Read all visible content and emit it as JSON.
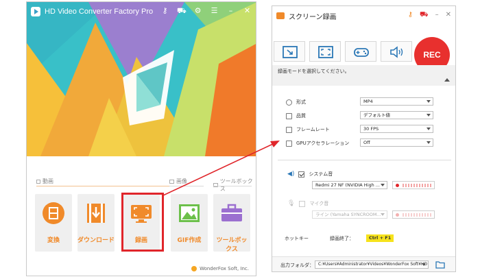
{
  "left_window": {
    "title": "HD Video Converter Factory Pro",
    "titlebar_icons": [
      "key-icon",
      "cart-icon",
      "gear-icon",
      "list-icon",
      "minimize-icon",
      "close-icon"
    ],
    "sections": {
      "video": "動画",
      "image": "画像",
      "toolbox": "ツールボックス"
    },
    "tools": [
      {
        "label": "変換",
        "icon": "film-convert-icon"
      },
      {
        "label": "ダウンロード",
        "icon": "download-icon"
      },
      {
        "label": "録画",
        "icon": "screen-record-icon"
      },
      {
        "label": "GIF作成",
        "icon": "image-icon"
      },
      {
        "label": "ツールボックス",
        "icon": "toolbox-icon"
      }
    ],
    "footer": "WonderFox Soft, Inc."
  },
  "right_window": {
    "title": "スクリーン録画",
    "titlebar_icons": [
      "key-icon",
      "cart-icon",
      "minimize-icon",
      "close-icon"
    ],
    "modes": [
      "region-capture-icon",
      "fullscreen-icon",
      "game-icon",
      "audio-only-icon"
    ],
    "rec_label": "REC",
    "hint": "録画モードを選択してください。",
    "rows": [
      {
        "label": "形式",
        "value": "MP4"
      },
      {
        "label": "品質",
        "value": "デフォルト値"
      },
      {
        "label": "フレームレート",
        "value": "30 FPS"
      },
      {
        "label": "GPUアクセラレーション",
        "value": "Off"
      }
    ],
    "system_audio": {
      "label": "システム音",
      "device": "Redmi 27 NF (NVIDIA High ..."
    },
    "mic": {
      "label": "マイク音",
      "device": "ライン (Yamaha SYNCROOM..."
    },
    "hotkey": {
      "label": "ホットキー",
      "stop_label": "録画終了：",
      "keys": "Ctrl + F1"
    },
    "output": {
      "label": "出力フォルダ：",
      "path": "C:¥Users¥Administrator¥Videos¥WonderFox Soft¥HD V"
    }
  },
  "colors": {
    "accent_orange": "#f08a2a",
    "rec_red": "#e8302e",
    "highlight_red": "#e0252a"
  }
}
